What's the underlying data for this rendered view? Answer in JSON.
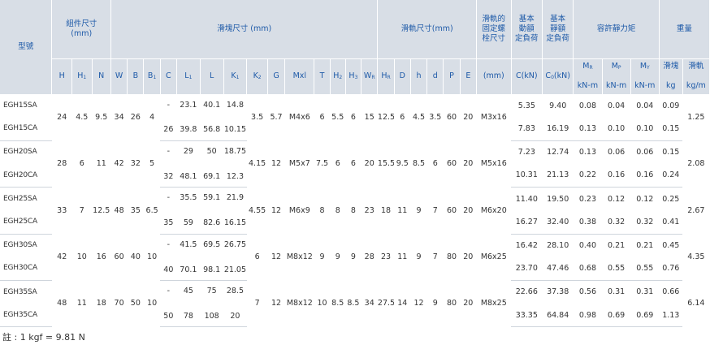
{
  "headers": {
    "model": "型號",
    "assembly": "組件尺寸\n(mm)",
    "block": "滑塊尺寸 (mm)",
    "rail": "滑軌尺寸(mm)",
    "rail_bolt": "滑軌的\n固定螺\n栓尺寸",
    "dyn": "基本\n動額\n定負荷",
    "stat": "基本\n靜額\n定負荷",
    "moment": "容許靜力矩",
    "weight": "重量",
    "weight_block": "滑塊",
    "weight_rail": "滑軌",
    "sub": {
      "H": "H",
      "H1": "H",
      "H1s": "1",
      "N": "N",
      "W": "W",
      "B": "B",
      "B1": "B",
      "B1s": "1",
      "C": "C",
      "L1": "L",
      "L1s": "1",
      "L": "L",
      "K1": "K",
      "K1s": "1",
      "K2": "K",
      "K2s": "2",
      "G": "G",
      "Mxl": "Mxl",
      "T": "T",
      "H2": "H",
      "H2s": "2",
      "H3": "H",
      "H3s": "3",
      "WR": "W",
      "WRs": "R",
      "HR": "H",
      "HRs": "R",
      "D": "D",
      "h": "h",
      "d": "d",
      "P": "P",
      "E": "E",
      "bolt": "(mm)",
      "C_unit": "C(kN)",
      "C0_unit": "C",
      "C0_s": "0",
      "C0_tail": "(kN)",
      "MR": "M",
      "MRs": "R",
      "MP": "M",
      "MPs": "P",
      "MY": "M",
      "MYs": "Y",
      "MR_unit": "kN-m",
      "MP_unit": "kN-m",
      "MY_unit": "kN-m",
      "wb_unit": "kg",
      "wr_unit": "kg/m"
    }
  },
  "groups": [
    {
      "H": "24",
      "H1": "4.5",
      "N": "9.5",
      "W": "34",
      "B": "26",
      "B1": "4",
      "K2": "3.5",
      "G": "5.7",
      "Mxl": "M4x6",
      "T": "6",
      "H2": "5.5",
      "H3": "6",
      "WR": "15",
      "HR": "12.5",
      "D": "6",
      "h": "4.5",
      "d": "3.5",
      "P": "60",
      "E": "20",
      "bolt": "M3x16",
      "rail_w": "1.25",
      "rows": [
        {
          "model": "EGH15SA",
          "C": "-",
          "L1": "23.1",
          "L": "40.1",
          "K1": "14.8",
          "C_dyn": "5.35",
          "C0": "9.40",
          "MR": "0.08",
          "MP": "0.04",
          "MY": "0.04",
          "wb": "0.09"
        },
        {
          "model": "EGH15CA",
          "C": "26",
          "L1": "39.8",
          "L": "56.8",
          "K1": "10.15",
          "C_dyn": "7.83",
          "C0": "16.19",
          "MR": "0.13",
          "MP": "0.10",
          "MY": "0.10",
          "wb": "0.15"
        }
      ]
    },
    {
      "H": "28",
      "H1": "6",
      "N": "11",
      "W": "42",
      "B": "32",
      "B1": "5",
      "K2": "4.15",
      "G": "12",
      "Mxl": "M5x7",
      "T": "7.5",
      "H2": "6",
      "H3": "6",
      "WR": "20",
      "HR": "15.5",
      "D": "9.5",
      "h": "8.5",
      "d": "6",
      "P": "60",
      "E": "20",
      "bolt": "M5x16",
      "rail_w": "2.08",
      "rows": [
        {
          "model": "EGH20SA",
          "C": "-",
          "L1": "29",
          "L": "50",
          "K1": "18.75",
          "C_dyn": "7.23",
          "C0": "12.74",
          "MR": "0.13",
          "MP": "0.06",
          "MY": "0.06",
          "wb": "0.15"
        },
        {
          "model": "EGH20CA",
          "C": "32",
          "L1": "48.1",
          "L": "69.1",
          "K1": "12.3",
          "C_dyn": "10.31",
          "C0": "21.13",
          "MR": "0.22",
          "MP": "0.16",
          "MY": "0.16",
          "wb": "0.24"
        }
      ]
    },
    {
      "H": "33",
      "H1": "7",
      "N": "12.5",
      "W": "48",
      "B": "35",
      "B1": "6.5",
      "K2": "4.55",
      "G": "12",
      "Mxl": "M6x9",
      "T": "8",
      "H2": "8",
      "H3": "8",
      "WR": "23",
      "HR": "18",
      "D": "11",
      "h": "9",
      "d": "7",
      "P": "60",
      "E": "20",
      "bolt": "M6x20",
      "rail_w": "2.67",
      "rows": [
        {
          "model": "EGH25SA",
          "C": "-",
          "L1": "35.5",
          "L": "59.1",
          "K1": "21.9",
          "C_dyn": "11.40",
          "C0": "19.50",
          "MR": "0.23",
          "MP": "0.12",
          "MY": "0.12",
          "wb": "0.25"
        },
        {
          "model": "EGH25CA",
          "C": "35",
          "L1": "59",
          "L": "82.6",
          "K1": "16.15",
          "C_dyn": "16.27",
          "C0": "32.40",
          "MR": "0.38",
          "MP": "0.32",
          "MY": "0.32",
          "wb": "0.41"
        }
      ]
    },
    {
      "H": "42",
      "H1": "10",
      "N": "16",
      "W": "60",
      "B": "40",
      "B1": "10",
      "K2": "6",
      "G": "12",
      "Mxl": "M8x12",
      "T": "9",
      "H2": "9",
      "H3": "9",
      "WR": "28",
      "HR": "23",
      "D": "11",
      "h": "9",
      "d": "7",
      "P": "80",
      "E": "20",
      "bolt": "M6x25",
      "rail_w": "4.35",
      "rows": [
        {
          "model": "EGH30SA",
          "C": "-",
          "L1": "41.5",
          "L": "69.5",
          "K1": "26.75",
          "C_dyn": "16.42",
          "C0": "28.10",
          "MR": "0.40",
          "MP": "0.21",
          "MY": "0.21",
          "wb": "0.45"
        },
        {
          "model": "EGH30CA",
          "C": "40",
          "L1": "70.1",
          "L": "98.1",
          "K1": "21.05",
          "C_dyn": "23.70",
          "C0": "47.46",
          "MR": "0.68",
          "MP": "0.55",
          "MY": "0.55",
          "wb": "0.76"
        }
      ]
    },
    {
      "H": "48",
      "H1": "11",
      "N": "18",
      "W": "70",
      "B": "50",
      "B1": "10",
      "K2": "7",
      "G": "12",
      "Mxl": "M8x12",
      "T": "10",
      "H2": "8.5",
      "H3": "8.5",
      "WR": "34",
      "HR": "27.5",
      "D": "14",
      "h": "12",
      "d": "9",
      "P": "80",
      "E": "20",
      "bolt": "M8x25",
      "rail_w": "6.14",
      "rows": [
        {
          "model": "EGH35SA",
          "C": "-",
          "L1": "45",
          "L": "75",
          "K1": "28.5",
          "C_dyn": "22.66",
          "C0": "37.38",
          "MR": "0.56",
          "MP": "0.31",
          "MY": "0.31",
          "wb": "0.66"
        },
        {
          "model": "EGH35CA",
          "C": "50",
          "L1": "78",
          "L": "108",
          "K1": "20",
          "C_dyn": "33.35",
          "C0": "64.84",
          "MR": "0.98",
          "MP": "0.69",
          "MY": "0.69",
          "wb": "1.13"
        }
      ]
    }
  ],
  "footnote": "註 : 1 kgf = 9.81 N"
}
